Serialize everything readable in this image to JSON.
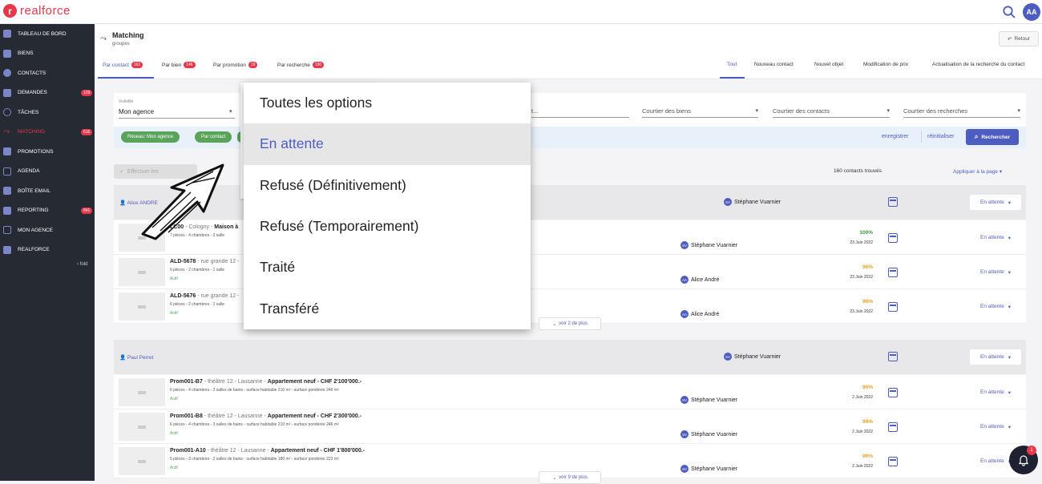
{
  "app": {
    "logo_text": "realforce",
    "user_initials": "AA"
  },
  "sidebar": {
    "items": [
      {
        "label": "TABLEAU DE BORD",
        "badge": ""
      },
      {
        "label": "BIENS",
        "badge": ""
      },
      {
        "label": "CONTACTS",
        "badge": ""
      },
      {
        "label": "DEMANDES",
        "badge": "129"
      },
      {
        "label": "TÂCHES",
        "badge": ""
      },
      {
        "label": "MATCHING",
        "badge": "616"
      },
      {
        "label": "PROMOTIONS",
        "badge": ""
      },
      {
        "label": "AGENDA",
        "badge": ""
      },
      {
        "label": "BOÎTE EMAIL",
        "badge": ""
      },
      {
        "label": "REPORTING",
        "badge": "841"
      },
      {
        "label": "MON AGENCE",
        "badge": ""
      },
      {
        "label": "REALFORCE",
        "badge": ""
      }
    ],
    "fold_label": "fold"
  },
  "header": {
    "title": "Matching",
    "subtitle": "groupes",
    "back_label": "Retour"
  },
  "tabs": {
    "left": [
      {
        "label": "Par contact",
        "badge": "161"
      },
      {
        "label": "Par bien",
        "badge": "146"
      },
      {
        "label": "Par promotion",
        "badge": "19"
      },
      {
        "label": "Par recherche",
        "badge": "190"
      }
    ],
    "right": [
      "Tout",
      "Nouveau contact",
      "Nouvel objet",
      "Modification de prix",
      "Actualisation de la recherche du contact"
    ]
  },
  "filters": {
    "visibility_label": "Visibilité",
    "visibility_value": "Mon agence",
    "partial_field": "t...",
    "courtier_biens": "Courtier des biens",
    "courtier_contacts": "Courtier des contacts",
    "courtier_recherches": "Courtier des recherches"
  },
  "chips": [
    "Réseau: Mon agence",
    "Par contact"
  ],
  "actions": {
    "save": "enregistrer",
    "reset": "réinitialiser",
    "search": "Rechercher",
    "bulk": "Effectuer les"
  },
  "results": {
    "count": "160 contacts trouvés",
    "apply": "Appliquer à la page"
  },
  "groups": [
    {
      "contact": "Alice ANDRE",
      "agent": "Stéphane Vuarnier",
      "agent_initials": "SV",
      "status": "En attente",
      "more": "voir 2 de plus",
      "rows": [
        {
          "ref": "LC00",
          "location": " - Cologny - ",
          "type": "Maison à",
          "desc": "7 pièces - 4 chambres - 2 salle",
          "state": "",
          "agent": "Stéphane Vuarnier",
          "agent_initials": "SV",
          "pct": "100%",
          "date": "23 Juin 2022",
          "status": "En attente"
        },
        {
          "ref": "ALD-5678",
          "location": " - rue grande 12 - ",
          "type": "",
          "desc": "6 pièces - 2 chambres - 1 salle",
          "state": "Actif",
          "agent": "Alice André",
          "agent_initials": "AA",
          "pct": "90%",
          "date": "23 Juin 2022",
          "status": "En attente"
        },
        {
          "ref": "ALD-5676",
          "location": " - rue grande 12 - ",
          "type": "",
          "desc": "6 pièces - 2 chambres - 1 salle",
          "state": "Actif",
          "agent": "Alice André",
          "agent_initials": "AA",
          "pct": "90%",
          "date": "23 Juin 2022",
          "status": "En attente"
        }
      ]
    },
    {
      "contact": "Paul Perret",
      "agent": "Stéphane Vuarnier",
      "agent_initials": "SV",
      "status": "En attente",
      "more": "voir 9 de plus",
      "rows": [
        {
          "ref": "Prom001-B7",
          "location": " - théâtre 12 - Lausanne - ",
          "type": "Appartement neuf - CHF 2'100'000.-",
          "desc": "6 pièces - 4 chambres - 3 salles de bains - surface habitable 210 m² - surface pondérée 246 m²",
          "state": "Actif",
          "agent": "Stéphane Vuarnier",
          "agent_initials": "SV",
          "pct": "90%",
          "date": "2 Juin 2022",
          "status": "En attente"
        },
        {
          "ref": "Prom001-B8",
          "location": " - théâtre 12 - Lausanne - ",
          "type": "Appartement neuf - CHF 2'300'000.-",
          "desc": "6 pièces - 4 chambres - 3 salles de bains - surface habitable 210 m² - surface pondérée 246 m²",
          "state": "Actif",
          "agent": "Stéphane Vuarnier",
          "agent_initials": "SV",
          "pct": "90%",
          "date": "2 Juin 2022",
          "status": "En attente"
        },
        {
          "ref": "Prom001-A10",
          "location": " - théâtre 12 - Lausanne - ",
          "type": "Appartement neuf - CHF 1'800'000.-",
          "desc": "5 pièces - 3 chambres - 2 salles de bains - surface habitable 180 m² - surface pondérée 223 m²",
          "state": "Actif",
          "agent": "Stéphane Vuarnier",
          "agent_initials": "SV",
          "pct": "90%",
          "date": "2 Juin 2022",
          "status": "En attente"
        }
      ]
    }
  ],
  "dropdown": {
    "options": [
      "Toutes les options",
      "En attente",
      "Refusé (Définitivement)",
      "Refusé (Temporairement)",
      "Traité",
      "Transféré"
    ],
    "selected": "En attente"
  },
  "notifications": {
    "count": "1"
  },
  "colors": {
    "brand": "#e8364a",
    "accent": "#4d5cc1",
    "sidebar": "#262a33",
    "success": "#5aa35a"
  }
}
